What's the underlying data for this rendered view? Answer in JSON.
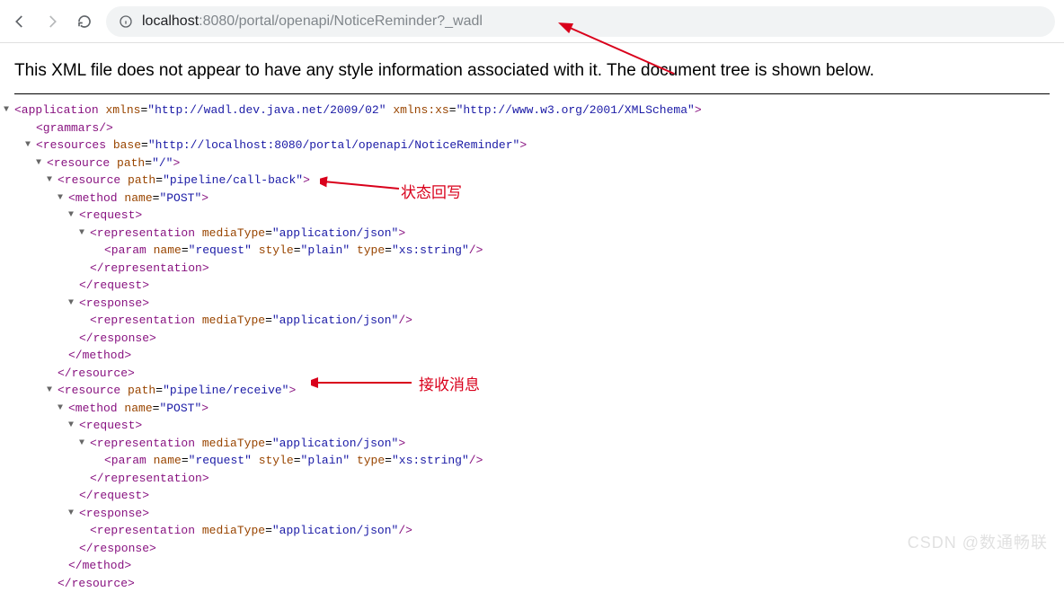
{
  "url": {
    "host": "localhost",
    "port": ":8080",
    "path": "/portal/openapi/NoticeReminder?_wadl"
  },
  "notice": "This XML file does not appear to have any style information associated with it. The document tree is shown below.",
  "xml": {
    "app_open": "<application xmlns=\"http://wadl.dev.java.net/2009/02\" xmlns:xs=\"http://www.w3.org/2001/XMLSchema\">",
    "grammars": "<grammars/>",
    "resources_open": "<resources base=\"http://localhost:8080/portal/openapi/NoticeReminder\">",
    "r0_open": "<resource path=\"/\">",
    "r1_open": "<resource path=\"pipeline/call-back\">",
    "m1_open": "<method name=\"POST\">",
    "req_open": "<request>",
    "rep_open": "<representation mediaType=\"application/json\">",
    "param": "<param name=\"request\" style=\"plain\" type=\"xs:string\"/>",
    "rep_close": "</representation>",
    "req_close": "</request>",
    "resp_open": "<response>",
    "rep_self": "<representation mediaType=\"application/json\"/>",
    "resp_close": "</response>",
    "m_close": "</method>",
    "r_close": "</resource>",
    "r2_open": "<resource path=\"pipeline/receive\">",
    "m2_open": "<method name=\"POST\">"
  },
  "labels": {
    "callback": "状态回写",
    "receive": "接收消息"
  },
  "watermark": "CSDN @数通畅联"
}
